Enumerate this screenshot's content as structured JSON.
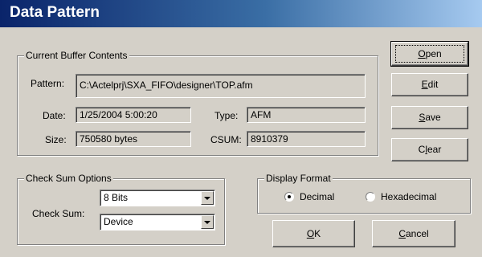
{
  "window": {
    "title": "Data Pattern"
  },
  "buffer": {
    "group_label": "Current Buffer Contents",
    "pattern_label": "Pattern:",
    "pattern_value": "C:\\Actelprj\\SXA_FIFO\\designer\\TOP.afm",
    "date_label": "Date:",
    "date_value": "1/25/2004 5:00:20",
    "type_label": "Type:",
    "type_value": "AFM",
    "size_label": "Size:",
    "size_value": "750580 bytes",
    "csum_label": "CSUM:",
    "csum_value": "8910379"
  },
  "checksum": {
    "group_label": "Check Sum Options",
    "label": "Check Sum:",
    "bits_value": "8  Bits",
    "source_value": "Device"
  },
  "display": {
    "group_label": "Display Format",
    "decimal_label": "Decimal",
    "hex_label": "Hexadecimal",
    "selected": "Decimal"
  },
  "buttons": {
    "open": {
      "accel": "O",
      "rest": "pen"
    },
    "edit": {
      "accel": "E",
      "rest": "dit"
    },
    "save": {
      "accel": "S",
      "rest": "ave"
    },
    "clear": {
      "pre": "C",
      "accel": "l",
      "rest": "ear"
    },
    "ok": {
      "accel": "O",
      "rest": "K"
    },
    "cancel": {
      "accel": "C",
      "rest": "ancel"
    }
  }
}
